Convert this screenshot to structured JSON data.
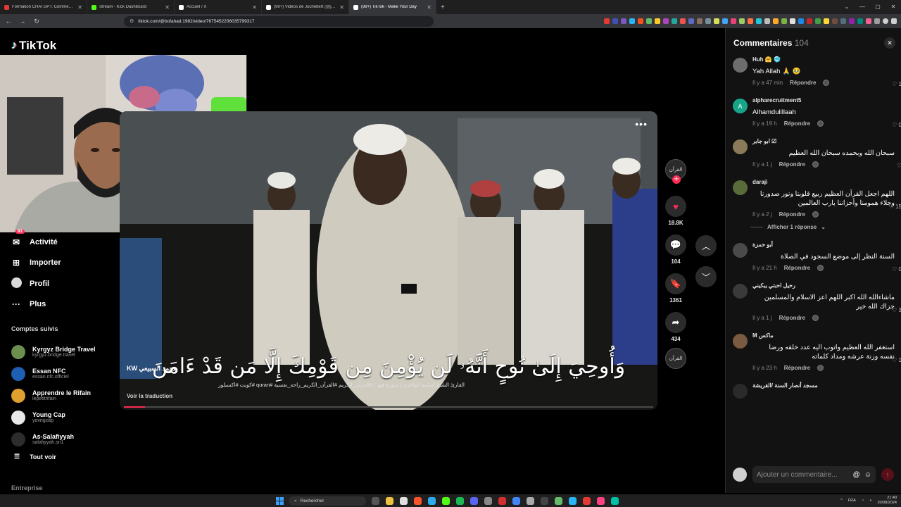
{
  "browser": {
    "tabs": [
      {
        "title": "Formation CHATGPT: Comment utilis...",
        "color": "#e53935",
        "active": false
      },
      {
        "title": "Stream - Kick Dashboard",
        "color": "#53fc18",
        "active": false
      },
      {
        "title": "Accueil / X",
        "color": "#ffffff",
        "active": false
      },
      {
        "title": "(99+) Vidéos de Juchebert (@jolbert...",
        "color": "#ffffff",
        "active": false
      },
      {
        "title": "(99+) TikTok - Make Your Day",
        "color": "#ffffff",
        "active": true
      }
    ],
    "url": "tiktok.com/@bofahad.1982/video/7675452206035799317"
  },
  "brand": {
    "name": "TikTok"
  },
  "sidebar": {
    "items": [
      {
        "label": "Activité",
        "icon": "inbox-icon",
        "badge": "83"
      },
      {
        "label": "Importer",
        "icon": "upload-icon"
      },
      {
        "label": "Profil",
        "icon": "profile-icon"
      },
      {
        "label": "Plus",
        "icon": "more-icon"
      }
    ],
    "followed_title": "Comptes suivis",
    "followed": [
      {
        "name": "Kyrgyz Bridge Travel",
        "user": "kyrgyz.bridge.travel",
        "color": "#6b8f4e"
      },
      {
        "name": "Essan NFC",
        "user": "essan.nfc.officiel",
        "color": "#1e5fb4"
      },
      {
        "name": "Apprendre le Rifain",
        "user": "lepetitrifain",
        "color": "#e0a030"
      },
      {
        "name": "Young Cap",
        "user": "yovngcap",
        "color": "#e8e8e8"
      },
      {
        "name": "As-Salafiyyah",
        "user": "salafiyyah.sn1",
        "color": "#2d2d2d"
      }
    ],
    "see_all": "Tout voir",
    "enterprise": "Entreprise"
  },
  "video": {
    "subtitle": "وَأُوحِيَ إِلَىٰ نُوحٍ أَنَّهُۥ لَن يُؤْمِنَ مِن قَوْمِكَ إِلَّا مَن قَدْ ءَامَنَ",
    "author": "محمد السبيعي KW",
    "description": "القارئ الشيخ أسامة الواجدي | سورة هود | #القرآن_الكريم #القرآن_الكريم_راحه_نفسية #quran #كويت #اكسبلور",
    "translate": "Voir la traduction",
    "progress": 0.04,
    "more": "•••"
  },
  "actions": {
    "avatar_text": "القرآن",
    "likes": "18.8K",
    "comments": "104",
    "saves": "1361",
    "shares": "434"
  },
  "comments_panel": {
    "title": "Commentaires",
    "count": "104",
    "input_placeholder": "Ajouter un commentaire...",
    "show_replies": "Afficher 1 réponse",
    "items": [
      {
        "user": "Huh 🤗 🥶",
        "text": "Yah Allah 🙏 🥹",
        "time": "Il y a 47 min",
        "reply": "Répondre",
        "likes": "1",
        "rtl": false,
        "av": "#6d6d6d",
        "initial": ""
      },
      {
        "user": "alpharecruitment5",
        "text": "Alhamdulillaah",
        "time": "Il y a 19 h",
        "reply": "Répondre",
        "likes": "0",
        "rtl": false,
        "av": "#17a589",
        "initial": "A"
      },
      {
        "user": "ابو جابر ☑",
        "text": "سبحان الله وبحمده سبحان الله العظيم",
        "time": "Il y a 1 j",
        "reply": "Répondre",
        "likes": "",
        "rtl": true,
        "av": "#8a7a5a",
        "initial": ""
      },
      {
        "user": "daraji",
        "text": "اللهم اجعل القرآن العظيم ربيع قلوبنا ونور صدورنا وجلاء همومنا وأحزاننا يارب العالمين",
        "time": "Il y a 2 j",
        "reply": "Répondre",
        "likes": "15",
        "rtl": true,
        "av": "#5a6b3a",
        "initial": ""
      },
      {
        "user": "أبو حمزة",
        "text": "السنة النظر إلى موضع السجود في الصلاة",
        "time": "Il y a 21 h",
        "reply": "Répondre",
        "likes": "0",
        "rtl": true,
        "av": "#4a4a4a",
        "initial": ""
      },
      {
        "user": "رحيل احبتي يبكيني",
        "text": "ماشاءالله الله اكبر اللهم اعز الاسلام والمسلمين جزاك الله خير",
        "time": "Il y a 1 j",
        "reply": "Répondre",
        "likes": "3",
        "rtl": true,
        "av": "#3a3a3a",
        "initial": ""
      },
      {
        "user": "M ماكس",
        "text": "استغفر الله العظيم واتوب اليه عدد خلقه ورضا نفسه وزنة عرشه ومداد كلماته",
        "time": "Il y a 23 h",
        "reply": "Répondre",
        "likes": "1",
        "rtl": true,
        "av": "#7a5a40",
        "initial": ""
      },
      {
        "user": "مسجد أنصار السنة /القريشة",
        "text": "",
        "time": "",
        "reply": "",
        "likes": "",
        "rtl": true,
        "av": "#2a2a2a",
        "initial": ""
      }
    ]
  },
  "taskbar": {
    "search": "Rechercher",
    "lang": "FRA",
    "time": "21:40",
    "date": "20/08/2024"
  }
}
